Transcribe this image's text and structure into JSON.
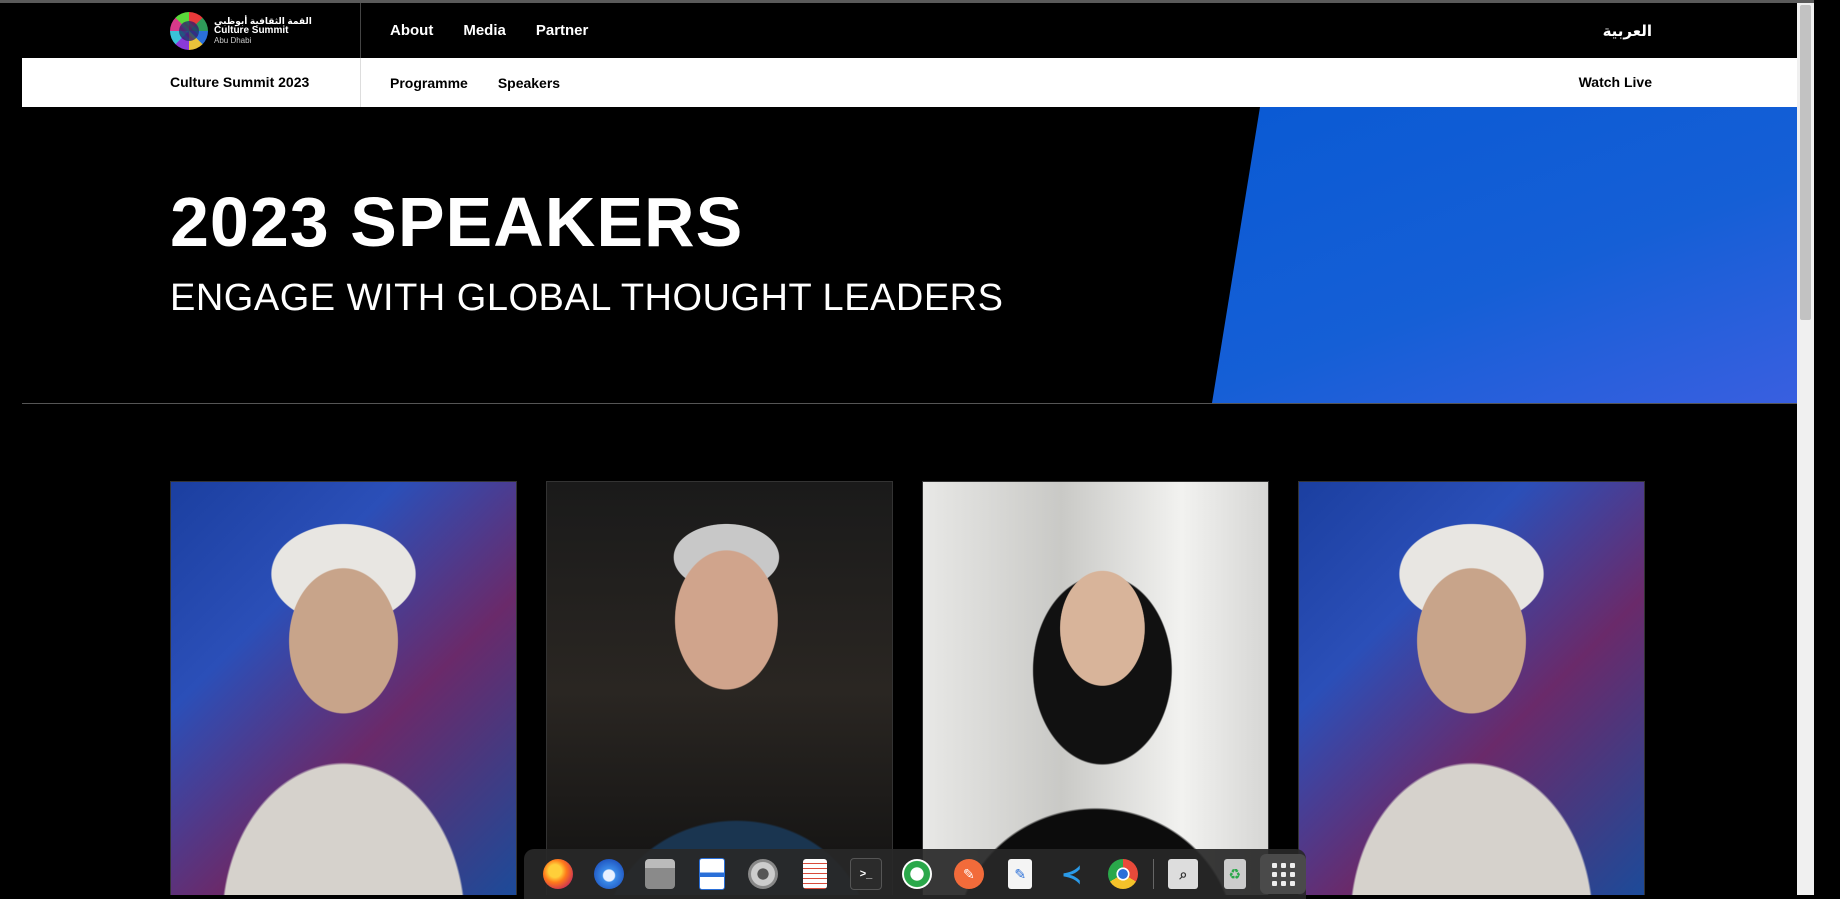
{
  "brand": {
    "logo_arabic": "القمة الثقافية أبوظبي",
    "logo_english": "Culture Summit",
    "logo_sub": "Abu Dhabi",
    "logo_icon": "culture-summit-logo"
  },
  "nav": {
    "items": [
      "About",
      "Media",
      "Partner"
    ],
    "language": "العربية"
  },
  "subnav": {
    "title": "Culture Summit 2023",
    "items": [
      "Programme",
      "Speakers"
    ],
    "watch_live": "Watch Live"
  },
  "hero": {
    "title": "2023 SPEAKERS",
    "subtitle": "ENGAGE WITH GLOBAL THOUGHT LEADERS",
    "accent_color": "#0a5ad4"
  },
  "speakers": [
    {
      "photo": "speaker-photo-man-ghutra"
    },
    {
      "photo": "speaker-photo-man-grey-hair"
    },
    {
      "photo": "speaker-photo-woman-shayla"
    },
    {
      "photo": "speaker-photo-man-ghutra"
    }
  ],
  "dock": {
    "apps": [
      "firefox-icon",
      "thunderbird-icon",
      "files-icon",
      "writer-icon",
      "settings-icon",
      "document-viewer-icon",
      "terminal-icon",
      "remmina-icon",
      "postman-icon",
      "text-editor-icon",
      "vscode-icon",
      "chrome-icon",
      "image-viewer-icon",
      "trash-icon"
    ],
    "grid": "show-apps-icon"
  }
}
